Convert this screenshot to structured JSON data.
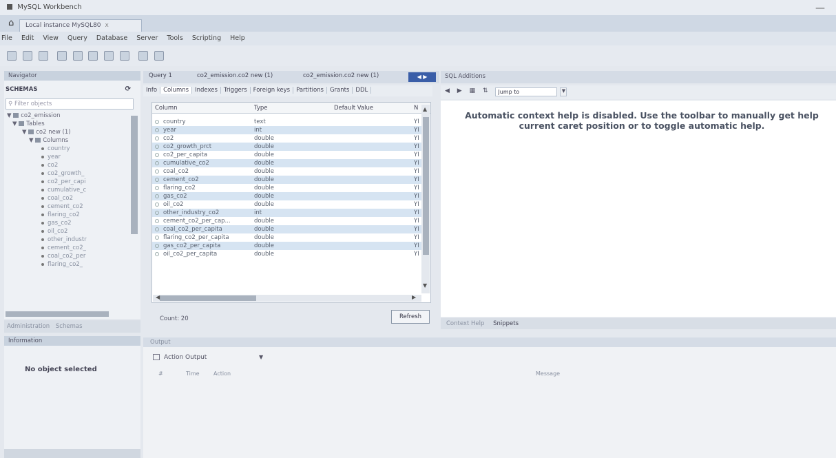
{
  "window": {
    "title": "MySQL Workbench"
  },
  "connection_tab": {
    "label": "Local instance MySQL80",
    "close": "x"
  },
  "menu": [
    "File",
    "Edit",
    "View",
    "Query",
    "Database",
    "Server",
    "Tools",
    "Scripting",
    "Help"
  ],
  "navigator": {
    "header": "Navigator",
    "schemas_label": "SCHEMAS",
    "filter_placeholder": "Filter objects",
    "tree": {
      "schema": "co2_emission",
      "tables": "Tables",
      "table": "co2 new (1)",
      "columns_folder": "Columns",
      "columns": [
        "country",
        "year",
        "co2",
        "co2_growth_",
        "co2_per_capi",
        "cumulative_c",
        "coal_co2",
        "cement_co2",
        "flaring_co2",
        "gas_co2",
        "oil_co2",
        "other_industr",
        "cement_co2_",
        "coal_co2_per",
        "flaring_co2_"
      ]
    },
    "bottom_tabs": [
      "Administration",
      "Schemas"
    ],
    "information_header": "Information",
    "no_object": "No object selected"
  },
  "query_tabs": [
    "Query 1",
    "co2_emission.co2 new (1)",
    "co2_emission.co2 new (1)"
  ],
  "subtabs": [
    "Info",
    "Columns",
    "Indexes",
    "Triggers",
    "Foreign keys",
    "Partitions",
    "Grants",
    "DDL"
  ],
  "grid": {
    "headers": {
      "column": "Column",
      "type": "Type",
      "default": "Default Value",
      "nullable": "N"
    },
    "rows": [
      {
        "name": "country",
        "type": "text",
        "n": "YI"
      },
      {
        "name": "year",
        "type": "int",
        "n": "YI"
      },
      {
        "name": "co2",
        "type": "double",
        "n": "YI"
      },
      {
        "name": "co2_growth_prct",
        "type": "double",
        "n": "YI"
      },
      {
        "name": "co2_per_capita",
        "type": "double",
        "n": "YI"
      },
      {
        "name": "cumulative_co2",
        "type": "double",
        "n": "YI"
      },
      {
        "name": "coal_co2",
        "type": "double",
        "n": "YI"
      },
      {
        "name": "cement_co2",
        "type": "double",
        "n": "YI"
      },
      {
        "name": "flaring_co2",
        "type": "double",
        "n": "YI"
      },
      {
        "name": "gas_co2",
        "type": "double",
        "n": "YI"
      },
      {
        "name": "oil_co2",
        "type": "double",
        "n": "YI"
      },
      {
        "name": "other_industry_co2",
        "type": "int",
        "n": "YI"
      },
      {
        "name": "cement_co2_per_cap...",
        "type": "double",
        "n": "YI"
      },
      {
        "name": "coal_co2_per_capita",
        "type": "double",
        "n": "YI"
      },
      {
        "name": "flaring_co2_per_capita",
        "type": "double",
        "n": "YI"
      },
      {
        "name": "gas_co2_per_capita",
        "type": "double",
        "n": "YI"
      },
      {
        "name": "oil_co2_per_capita",
        "type": "double",
        "n": "YI"
      }
    ],
    "count": "Count: 20",
    "refresh": "Refresh"
  },
  "sql_additions": {
    "header": "SQL Additions",
    "jump_to": "Jump to",
    "message_line1": "Automatic context help is disabled. Use the toolbar to manually get help",
    "message_line2": "current caret position or to toggle automatic help.",
    "tabs": [
      "Context Help",
      "Snippets"
    ]
  },
  "output": {
    "header": "Output",
    "selector": "Action Output",
    "columns": {
      "num": "#",
      "time": "Time",
      "action": "Action",
      "message": "Message"
    }
  }
}
